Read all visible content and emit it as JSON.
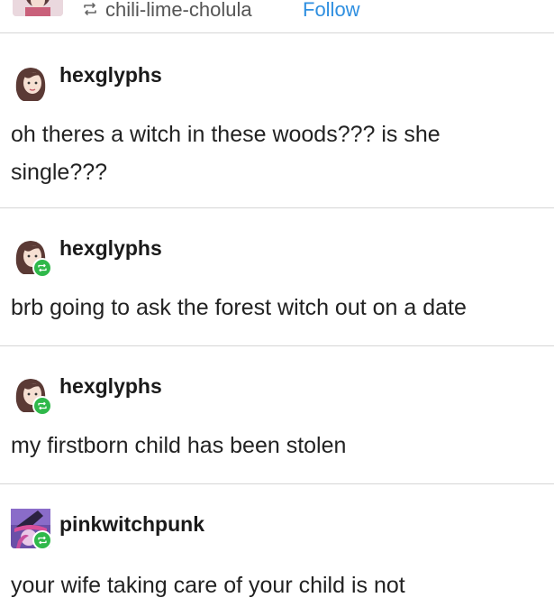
{
  "header": {
    "reblogged_from": "chili-lime-cholula",
    "follow_label": "Follow",
    "avatar_icon": "avatar-image",
    "reblog_icon": "reblog-icon"
  },
  "posts": [
    {
      "username": "hexglyphs",
      "reblogged": false,
      "text": "oh theres a witch in these woods??? is she single???"
    },
    {
      "username": "hexglyphs",
      "reblogged": true,
      "text": "brb going to ask the forest witch out on a date"
    },
    {
      "username": "hexglyphs",
      "reblogged": true,
      "text": "my firstborn child has been stolen"
    },
    {
      "username": "pinkwitchpunk",
      "reblogged": true,
      "text": "your wife taking care of your child is not"
    }
  ],
  "colors": {
    "link_blue": "#2f8fe0",
    "reblog_green": "#2fb84a",
    "divider": "#d6d6d6"
  }
}
